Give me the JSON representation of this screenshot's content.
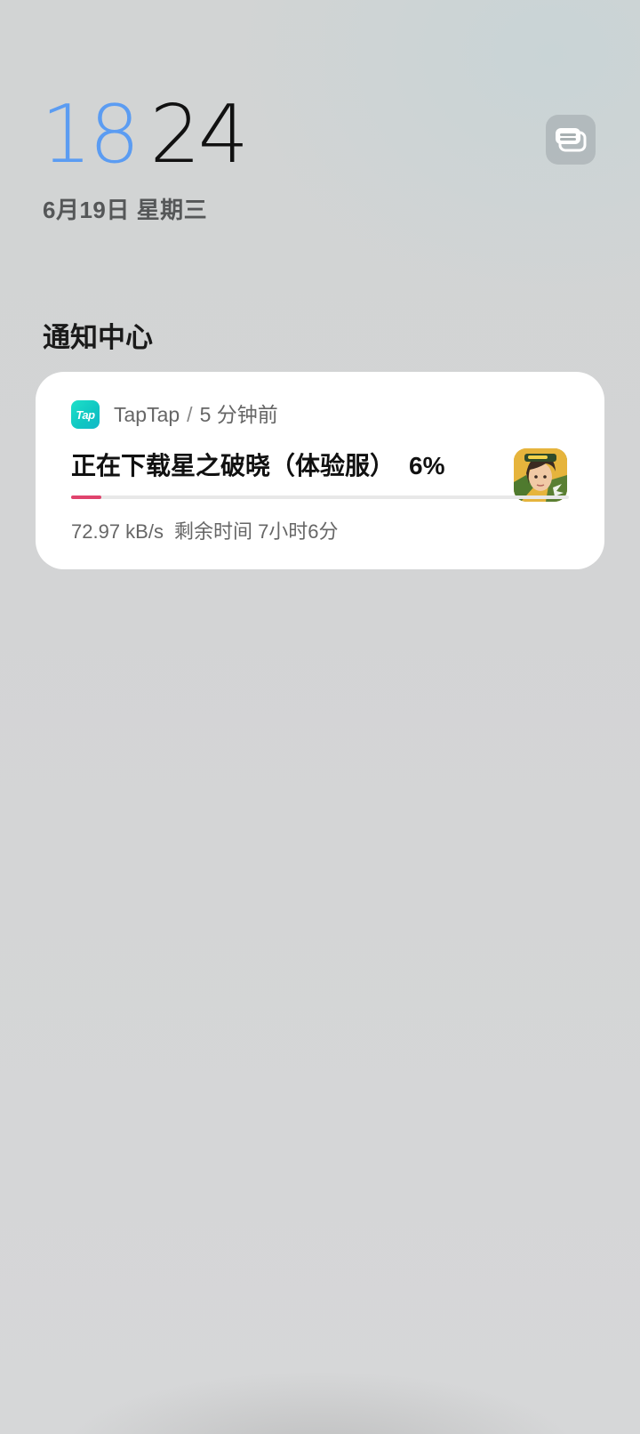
{
  "lockscreen": {
    "clock_hour": "18",
    "clock_minute": "24",
    "date": "6月19日 星期三"
  },
  "notification_center": {
    "title": "通知中心"
  },
  "icons": {
    "multitask": "notification-stack-icon",
    "app": "taptap-app-icon",
    "thumbnail": "game-thumbnail-icon"
  },
  "notification": {
    "app_icon_text": "Tap",
    "app_name": "TapTap",
    "separator": "/",
    "time_ago": "5 分钟前",
    "title": "正在下载星之破晓（体验服）",
    "percent_text": "6%",
    "progress": 0.06,
    "speed": "72.97 kB/s",
    "remaining": "剩余时间 7小时6分"
  },
  "colors": {
    "clock_hour": "#5b9cf2",
    "progress_fill": "#e0436d",
    "app_accent": "#10c9c3"
  }
}
